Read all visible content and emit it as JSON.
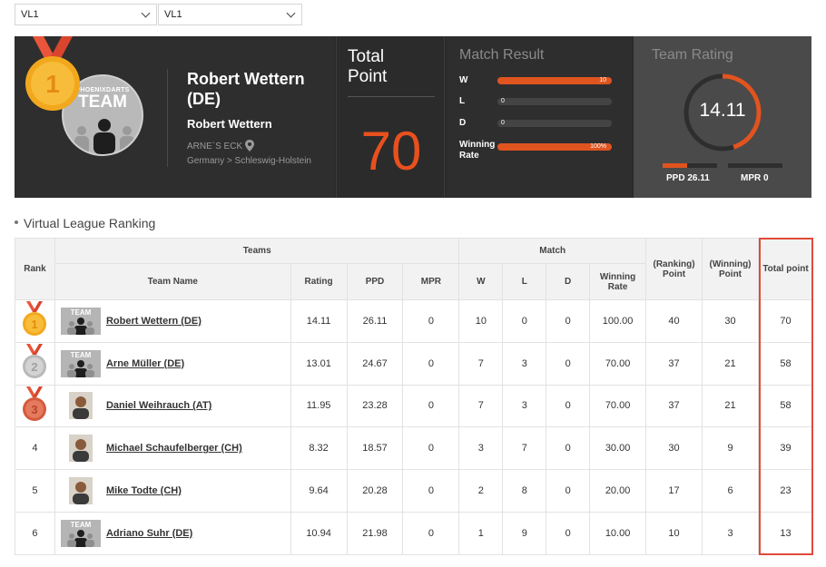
{
  "filters": {
    "select1": "VL1",
    "select2": "VL1"
  },
  "profile": {
    "avatar_brand": "PHOENIXDARTS",
    "avatar_team": "TEAM",
    "medal_rank": "1",
    "name": "Robert Wettern (DE)",
    "sub_name": "Robert Wettern",
    "shop": "ARNE`S ECK",
    "location": "Germany > Schleswig-Holstein"
  },
  "total": {
    "label": "Total Point",
    "value": "70"
  },
  "match_result": {
    "title": "Match Result",
    "rows": [
      {
        "label": "W",
        "value": "10",
        "fill": 1.0
      },
      {
        "label": "L",
        "value": "0",
        "fill": 0.0
      },
      {
        "label": "D",
        "value": "0",
        "fill": 0.0
      },
      {
        "label": "Winning Rate",
        "value": "100%",
        "fill": 1.0
      }
    ]
  },
  "team_rating": {
    "title": "Team Rating",
    "value": "14.11",
    "ring_fill": 0.45,
    "ppd_label": "PPD 26.11",
    "ppd_fill": 0.45,
    "mpr_label": "MPR 0",
    "mpr_fill": 0.0
  },
  "section_title": "Virtual League Ranking",
  "table": {
    "group_headers": {
      "rank": "Rank",
      "teams": "Teams",
      "match": "Match",
      "ranking_point": "(Ranking) Point",
      "winning_point": "(Winning) Point",
      "total_point": "Total point"
    },
    "columns": {
      "team_name": "Team Name",
      "rating": "Rating",
      "ppd": "PPD",
      "mpr": "MPR",
      "w": "W",
      "l": "L",
      "d": "D",
      "winning_rate": "Winning Rate"
    },
    "rows": [
      {
        "rank": "1",
        "medal": "gold",
        "thumb": "team",
        "thumb_text": "TEAM",
        "name": "Robert Wettern (DE)",
        "rating": "14.11",
        "ppd": "26.11",
        "mpr": "0",
        "w": "10",
        "l": "0",
        "d": "0",
        "winning_rate": "100.00",
        "ranking_point": "40",
        "winning_point": "30",
        "total_point": "70"
      },
      {
        "rank": "2",
        "medal": "silver",
        "thumb": "team",
        "thumb_text": "TEAM",
        "name": "Arne Müller (DE)",
        "rating": "13.01",
        "ppd": "24.67",
        "mpr": "0",
        "w": "7",
        "l": "3",
        "d": "0",
        "winning_rate": "70.00",
        "ranking_point": "37",
        "winning_point": "21",
        "total_point": "58"
      },
      {
        "rank": "3",
        "medal": "bronze",
        "thumb": "photo",
        "thumb_text": "",
        "name": "Daniel Weihrauch (AT)",
        "rating": "11.95",
        "ppd": "23.28",
        "mpr": "0",
        "w": "7",
        "l": "3",
        "d": "0",
        "winning_rate": "70.00",
        "ranking_point": "37",
        "winning_point": "21",
        "total_point": "58"
      },
      {
        "rank": "4",
        "medal": "",
        "thumb": "photo",
        "thumb_text": "",
        "name": "Michael Schaufelberger (CH)",
        "rating": "8.32",
        "ppd": "18.57",
        "mpr": "0",
        "w": "3",
        "l": "7",
        "d": "0",
        "winning_rate": "30.00",
        "ranking_point": "30",
        "winning_point": "9",
        "total_point": "39"
      },
      {
        "rank": "5",
        "medal": "",
        "thumb": "photo",
        "thumb_text": "",
        "name": "Mike Todte (CH)",
        "rating": "9.64",
        "ppd": "20.28",
        "mpr": "0",
        "w": "2",
        "l": "8",
        "d": "0",
        "winning_rate": "20.00",
        "ranking_point": "17",
        "winning_point": "6",
        "total_point": "23"
      },
      {
        "rank": "6",
        "medal": "",
        "thumb": "team",
        "thumb_text": "TEAM",
        "name": "Adriano Suhr (DE)",
        "rating": "10.94",
        "ppd": "21.98",
        "mpr": "0",
        "w": "1",
        "l": "9",
        "d": "0",
        "winning_rate": "10.00",
        "ranking_point": "10",
        "winning_point": "3",
        "total_point": "13"
      }
    ]
  },
  "colors": {
    "accent": "#e0541f",
    "highlight_border": "#e04a3a",
    "gold": "#f0a020",
    "silver": "#bdbdbd",
    "bronze": "#d9684a"
  }
}
